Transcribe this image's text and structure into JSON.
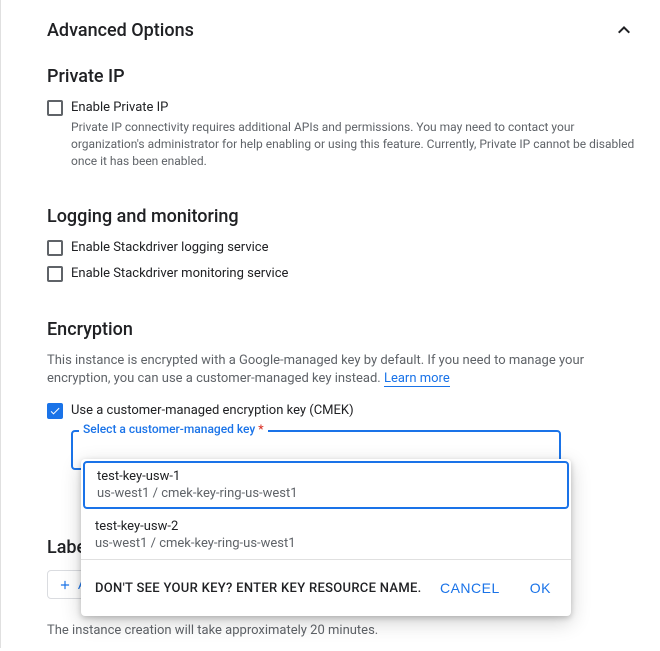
{
  "accordion": {
    "title": "Advanced Options"
  },
  "private_ip": {
    "title": "Private IP",
    "checkbox_label": "Enable Private IP",
    "help": "Private IP connectivity requires additional APIs and permissions. You may need to contact your organization's administrator for help enabling or using this feature. Currently, Private IP cannot be disabled once it has been enabled."
  },
  "logging": {
    "title": "Logging and monitoring",
    "opt_logging": "Enable Stackdriver logging service",
    "opt_monitoring": "Enable Stackdriver monitoring service"
  },
  "encryption": {
    "title": "Encryption",
    "desc_a": "This instance is encrypted with a Google-managed key by default. If you need to manage your encryption, you can use a customer-managed key instead. ",
    "learn_more": "Learn more",
    "cmek_label": "Use a customer-managed encryption key (CMEK)",
    "select_label": "Select a customer-managed key",
    "keys": [
      {
        "name": "test-key-usw-1",
        "path": "us-west1 / cmek-key-ring-us-west1"
      },
      {
        "name": "test-key-usw-2",
        "path": "us-west1 / cmek-key-ring-us-west1"
      }
    ],
    "footer_prompt": "DON'T SEE YOUR KEY? ENTER KEY RESOURCE NAME.",
    "cancel": "CANCEL",
    "ok": "OK"
  },
  "labels": {
    "title": "Labels",
    "add_btn": "ADD LABEL"
  },
  "footer": {
    "note": "The instance creation will take approximately 20 minutes."
  }
}
